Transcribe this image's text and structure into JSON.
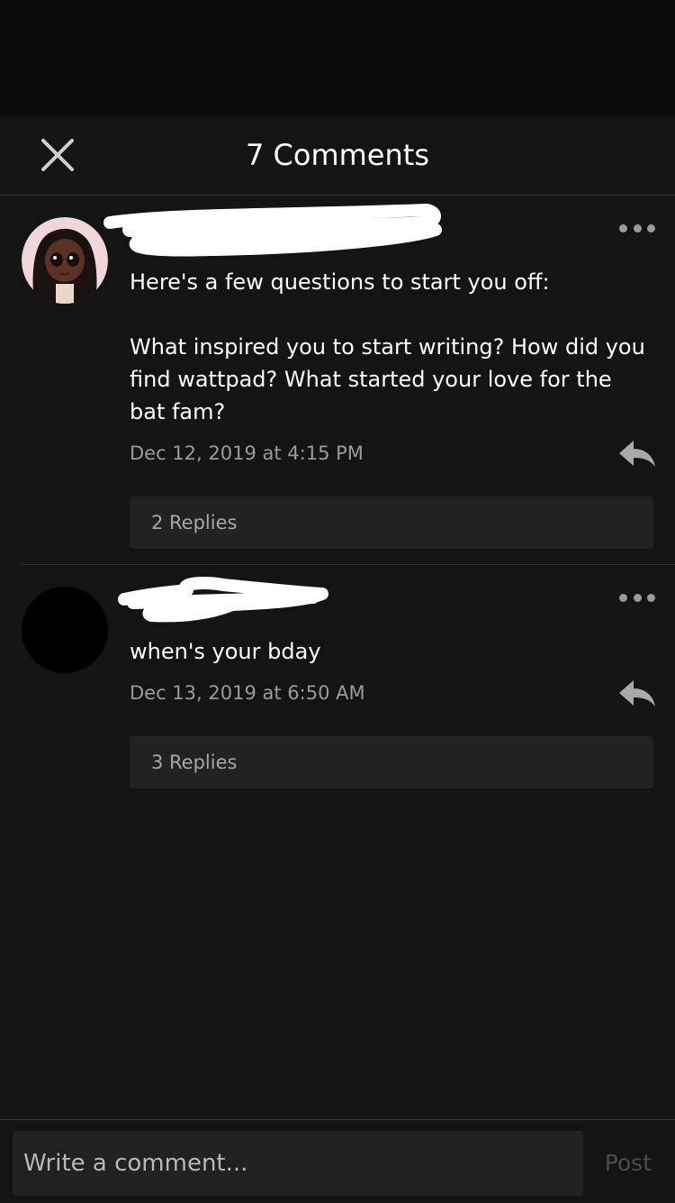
{
  "header": {
    "title": "7 Comments"
  },
  "comments": [
    {
      "text": "Here's a few questions to start you off:\n\nWhat inspired you to start writing? How did you find wattpad? What started your love for the bat fam?",
      "timestamp": "Dec 12, 2019 at 4:15 PM",
      "replies_label": "2 Replies"
    },
    {
      "text": "when's your bday",
      "timestamp": "Dec 13, 2019 at 6:50 AM",
      "replies_label": "3 Replies"
    }
  ],
  "composer": {
    "placeholder": "Write a comment...",
    "post_label": "Post"
  },
  "icons": {
    "close": "close-icon",
    "more": "more-horizontal-icon",
    "reply": "reply-arrow-icon"
  },
  "colors": {
    "background": "#141414",
    "status_bar": "#0a0a0a",
    "secondary_text": "#9b9b9b",
    "replies_bg": "#222222",
    "post_disabled": "#4d4d4d"
  }
}
